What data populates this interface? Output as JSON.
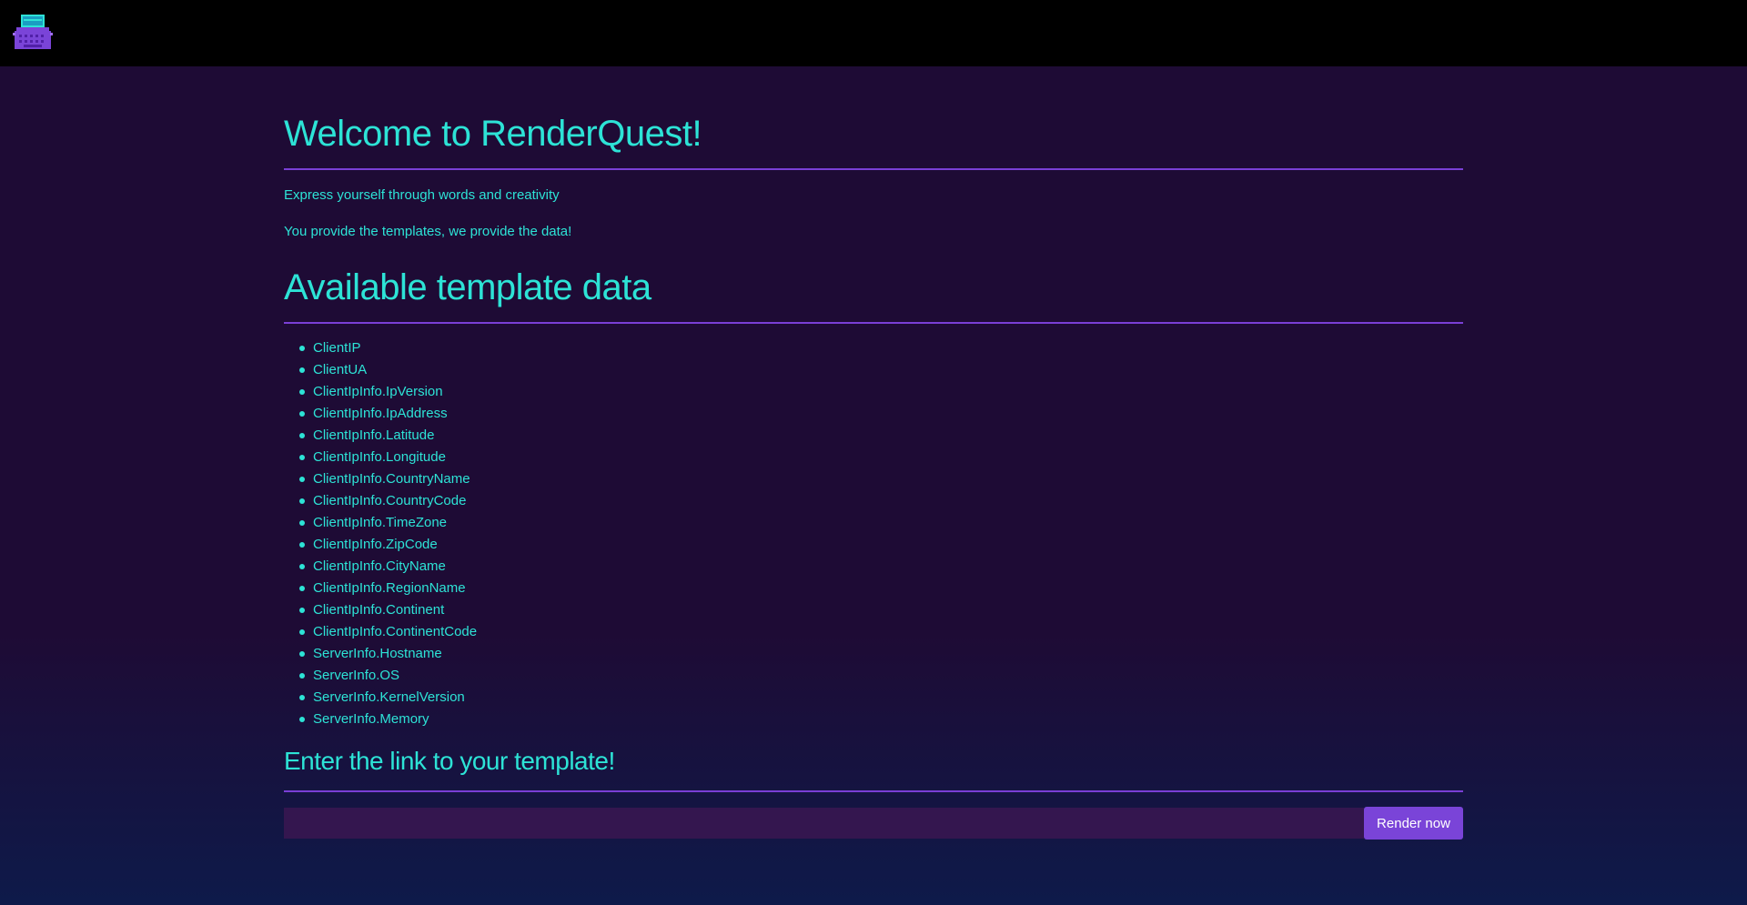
{
  "logo": {
    "icon": "typewriter-icon"
  },
  "colors": {
    "accent_text": "#2de3d6",
    "divider": "#7a3fd6",
    "button": "#7a44d8",
    "input_bg": "#34164f",
    "topbar_bg": "#000000",
    "page_bg": "#1e0b35"
  },
  "welcome": {
    "title": "Welcome to RenderQuest!",
    "tagline_1": "Express yourself through words and creativity",
    "tagline_2": "You provide the templates, we provide the data!"
  },
  "available": {
    "title": "Available template data",
    "items": [
      "ClientIP",
      "ClientUA",
      "ClientIpInfo.IpVersion",
      "ClientIpInfo.IpAddress",
      "ClientIpInfo.Latitude",
      "ClientIpInfo.Longitude",
      "ClientIpInfo.CountryName",
      "ClientIpInfo.CountryCode",
      "ClientIpInfo.TimeZone",
      "ClientIpInfo.ZipCode",
      "ClientIpInfo.CityName",
      "ClientIpInfo.RegionName",
      "ClientIpInfo.Continent",
      "ClientIpInfo.ContinentCode",
      "ServerInfo.Hostname",
      "ServerInfo.OS",
      "ServerInfo.KernelVersion",
      "ServerInfo.Memory"
    ]
  },
  "template_form": {
    "title": "Enter the link to your template!",
    "input_value": "",
    "input_placeholder": "",
    "button_label": "Render now"
  }
}
